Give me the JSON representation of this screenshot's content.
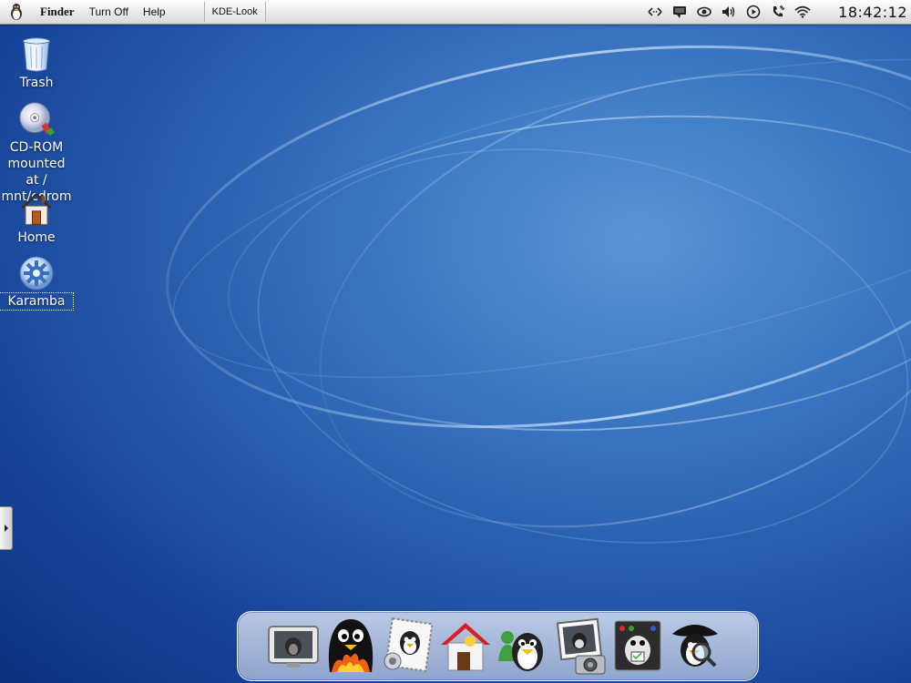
{
  "menubar": {
    "app_name": "Finder",
    "menu_turn_off": "Turn Off",
    "menu_help": "Help",
    "task_button": "KDE-Look",
    "clock": "18:42:12",
    "tray_icons": [
      "network-icon",
      "chat-icon",
      "eye-icon",
      "volume-icon",
      "play-icon",
      "phone-icon",
      "wifi-icon"
    ]
  },
  "desktop_icons": [
    {
      "name": "trash",
      "label": "Trash"
    },
    {
      "name": "cdrom",
      "label_lines": [
        "CD-ROM",
        "mounted at /",
        "mnt/cdrom"
      ]
    },
    {
      "name": "home",
      "label": "Home"
    },
    {
      "name": "karamba",
      "label": "Karamba",
      "selected": true
    }
  ],
  "dock": {
    "items": [
      "tv-penguin-icon",
      "fire-penguin-icon",
      "mail-stamp-penguin-icon",
      "home-penguin-icon",
      "messenger-penguin-icon",
      "camera-penguin-icon",
      "system-monitor-penguin-icon",
      "search-pirate-penguin-icon"
    ]
  },
  "colors": {
    "menubar": "#e8e8e8",
    "wallpaper_dark": "#0d2f80",
    "wallpaper_light": "#5c95d3"
  }
}
